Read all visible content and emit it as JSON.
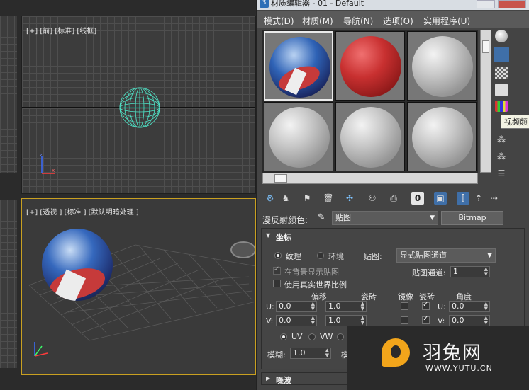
{
  "viewports": {
    "front": {
      "label": "[+] [前] [标准] [线框]"
    },
    "perspective": {
      "label": "[+] [透视 ] [标准 ] [默认明暗处理 ]"
    }
  },
  "editor": {
    "title": "材质编辑器 - 01 - Default",
    "title_icon": "3",
    "menu": [
      "模式(D)",
      "材质(M)",
      "导航(N)",
      "选项(O)",
      "实用程序(U)"
    ],
    "tooltip": "视频颜",
    "toolbar_num": "0"
  },
  "diffuse": {
    "label": "漫反射颜色:",
    "type_value": "贴图",
    "bitmap_button": "Bitmap"
  },
  "coords": {
    "title": "坐标",
    "texture_label": "纹理",
    "env_label": "环境",
    "mapping_label": "贴图:",
    "mapping_value": "显式贴图通道",
    "show_in_bg": "在背景显示贴图",
    "channel_label": "贴图通道:",
    "channel_value": "1",
    "real_world": "使用真实世界比例",
    "headers": {
      "offset": "偏移",
      "tiling": "瓷砖",
      "mirror": "镜像",
      "tile": "瓷砖",
      "angle": "角度"
    },
    "u_label": "U:",
    "v_label": "V:",
    "u_offset": "0.0",
    "v_offset": "0.0",
    "u_tiling": "1.0",
    "v_tiling": "1.0",
    "u_angle_label": "U:",
    "v_angle_label": "V:",
    "u_angle": "0.0",
    "v_angle": "0.0",
    "uv": "UV",
    "vw": "VW",
    "blur_label": "模糊:",
    "blur_value": "1.0",
    "blur_offset_label": "模"
  },
  "noise": {
    "title": "噪波"
  },
  "watermark": {
    "title": "羽兔网",
    "url": "WWW.YUTU.CN"
  },
  "colors": {
    "wireframe_sphere": "#4fe6c9",
    "editor_bg": "#444444",
    "accent": "#f2a51b"
  }
}
